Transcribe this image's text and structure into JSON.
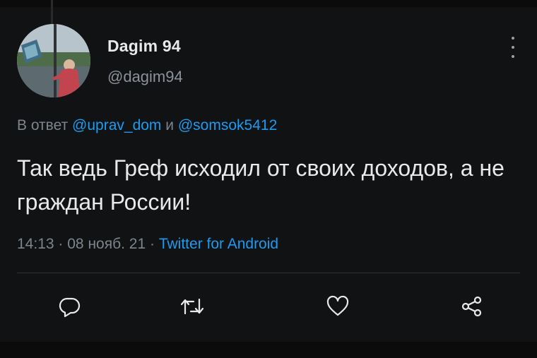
{
  "author": {
    "display_name": "Dagim 94",
    "handle": "@dagim94",
    "avatar_icon": "user-avatar"
  },
  "reply": {
    "prefix": "В ответ",
    "mention_1": "@uprav_dom",
    "conjunction": "и",
    "mention_2": "@somsok5412"
  },
  "tweet": {
    "text": "Так ведь Греф исходил от своих доходов, а не граждан России!"
  },
  "meta": {
    "time": "14:13",
    "separator": "·",
    "date": "08 нояб. 21",
    "source": "Twitter for Android"
  },
  "actions": {
    "reply_icon": "reply-icon",
    "retweet_icon": "retweet-icon",
    "like_icon": "heart-icon",
    "share_icon": "share-icon"
  },
  "colors": {
    "background": "#111214",
    "text_primary": "#e7e9ea",
    "text_secondary": "#7d858c",
    "link": "#1d9bf0",
    "divider": "#2f3336"
  }
}
